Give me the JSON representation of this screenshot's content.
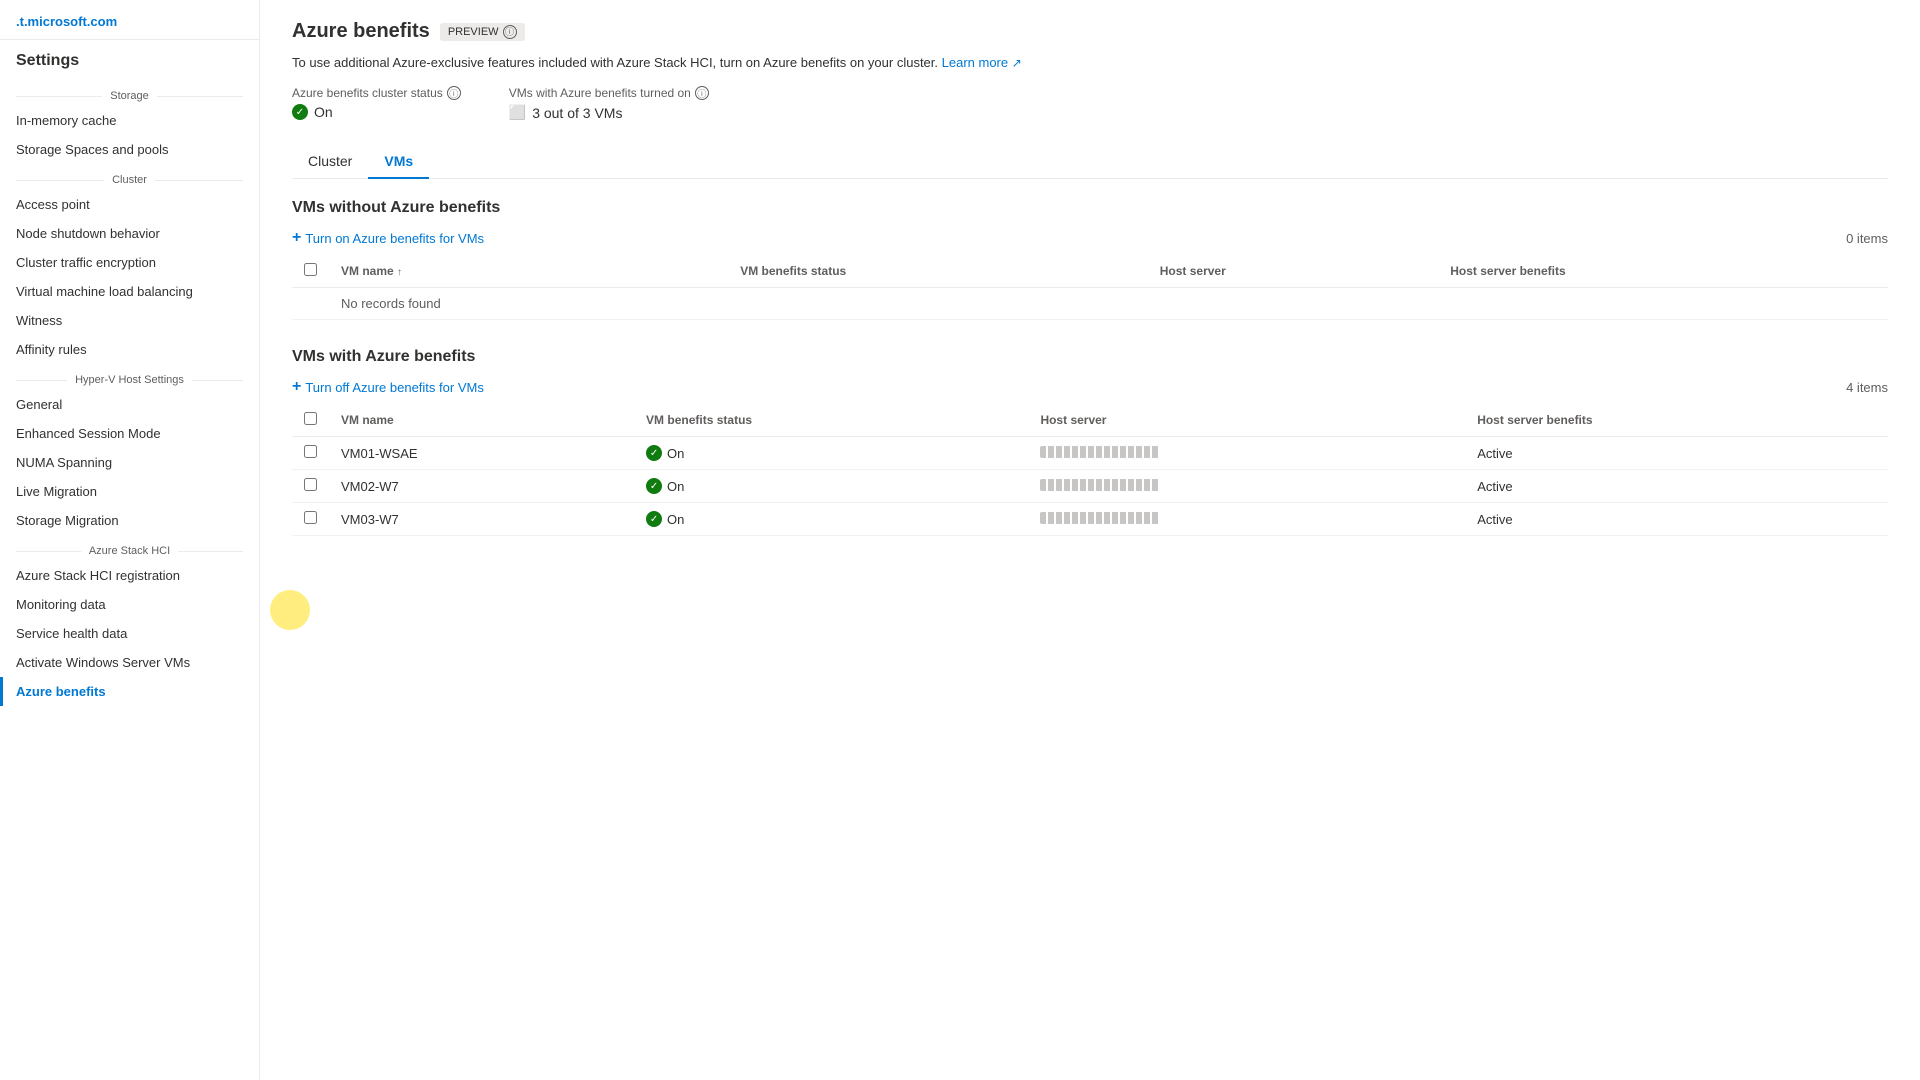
{
  "domain": ".t.microsoft.com",
  "sidebar": {
    "title": "Settings",
    "sections": [
      {
        "label": "Storage",
        "items": [
          {
            "id": "in-memory-cache",
            "label": "In-memory cache",
            "active": false
          },
          {
            "id": "storage-spaces",
            "label": "Storage Spaces and pools",
            "active": false
          }
        ]
      },
      {
        "label": "Cluster",
        "items": [
          {
            "id": "access-point",
            "label": "Access point",
            "active": false
          },
          {
            "id": "node-shutdown",
            "label": "Node shutdown behavior",
            "active": false
          },
          {
            "id": "cluster-traffic",
            "label": "Cluster traffic encryption",
            "active": false
          },
          {
            "id": "vm-load-balancing",
            "label": "Virtual machine load balancing",
            "active": false
          },
          {
            "id": "witness",
            "label": "Witness",
            "active": false
          },
          {
            "id": "affinity-rules",
            "label": "Affinity rules",
            "active": false
          }
        ]
      },
      {
        "label": "Hyper-V Host Settings",
        "items": [
          {
            "id": "general",
            "label": "General",
            "active": false
          },
          {
            "id": "enhanced-session-mode",
            "label": "Enhanced Session Mode",
            "active": false
          },
          {
            "id": "numa-spanning",
            "label": "NUMA Spanning",
            "active": false
          },
          {
            "id": "live-migration",
            "label": "Live Migration",
            "active": false
          },
          {
            "id": "storage-migration",
            "label": "Storage Migration",
            "active": false
          }
        ]
      },
      {
        "label": "Azure Stack HCI",
        "items": [
          {
            "id": "azure-stack-hci-reg",
            "label": "Azure Stack HCI registration",
            "active": false
          },
          {
            "id": "monitoring-data",
            "label": "Monitoring data",
            "active": false
          },
          {
            "id": "service-health",
            "label": "Service health data",
            "active": false
          },
          {
            "id": "activate-windows",
            "label": "Activate Windows Server VMs",
            "active": false
          },
          {
            "id": "azure-benefits",
            "label": "Azure benefits",
            "active": true
          }
        ]
      }
    ]
  },
  "page": {
    "title": "Azure benefits",
    "preview_label": "PREVIEW",
    "description": "To use additional Azure-exclusive features included with Azure Stack HCI, turn on Azure benefits on your cluster.",
    "learn_more_label": "Learn more",
    "cluster_status_label": "Azure benefits cluster status",
    "cluster_status_value": "On",
    "vms_status_label": "VMs with Azure benefits turned on",
    "vms_status_value": "3 out of 3 VMs"
  },
  "tabs": [
    {
      "id": "cluster",
      "label": "Cluster",
      "active": false
    },
    {
      "id": "vms",
      "label": "VMs",
      "active": true
    }
  ],
  "vms_without": {
    "title": "VMs without Azure benefits",
    "action_label": "Turn on Azure benefits for VMs",
    "items_count": "0 items",
    "columns": [
      {
        "label": "VM name",
        "sortable": true
      },
      {
        "label": "VM benefits status",
        "sortable": false
      },
      {
        "label": "Host server",
        "sortable": false
      },
      {
        "label": "Host server benefits",
        "sortable": false
      }
    ],
    "rows": [],
    "empty_label": "No records found"
  },
  "vms_with": {
    "title": "VMs with Azure benefits",
    "action_label": "Turn off Azure benefits for VMs",
    "items_count": "4 items",
    "columns": [
      {
        "label": "VM name",
        "sortable": false
      },
      {
        "label": "VM benefits status",
        "sortable": false
      },
      {
        "label": "Host server",
        "sortable": false
      },
      {
        "label": "Host server benefits",
        "sortable": false
      }
    ],
    "rows": [
      {
        "name": "VM01-WSAE",
        "status": "On",
        "host_server": "blurred",
        "host_benefits": "Active"
      },
      {
        "name": "VM02-W7",
        "status": "On",
        "host_server": "blurred",
        "host_benefits": "Active"
      },
      {
        "name": "VM03-W7",
        "status": "On",
        "host_server": "blurred",
        "host_benefits": "Active"
      }
    ]
  },
  "icons": {
    "info": "ⓘ",
    "check": "✓",
    "external_link": "↗",
    "plus": "+",
    "vm_icon": "⬜"
  }
}
